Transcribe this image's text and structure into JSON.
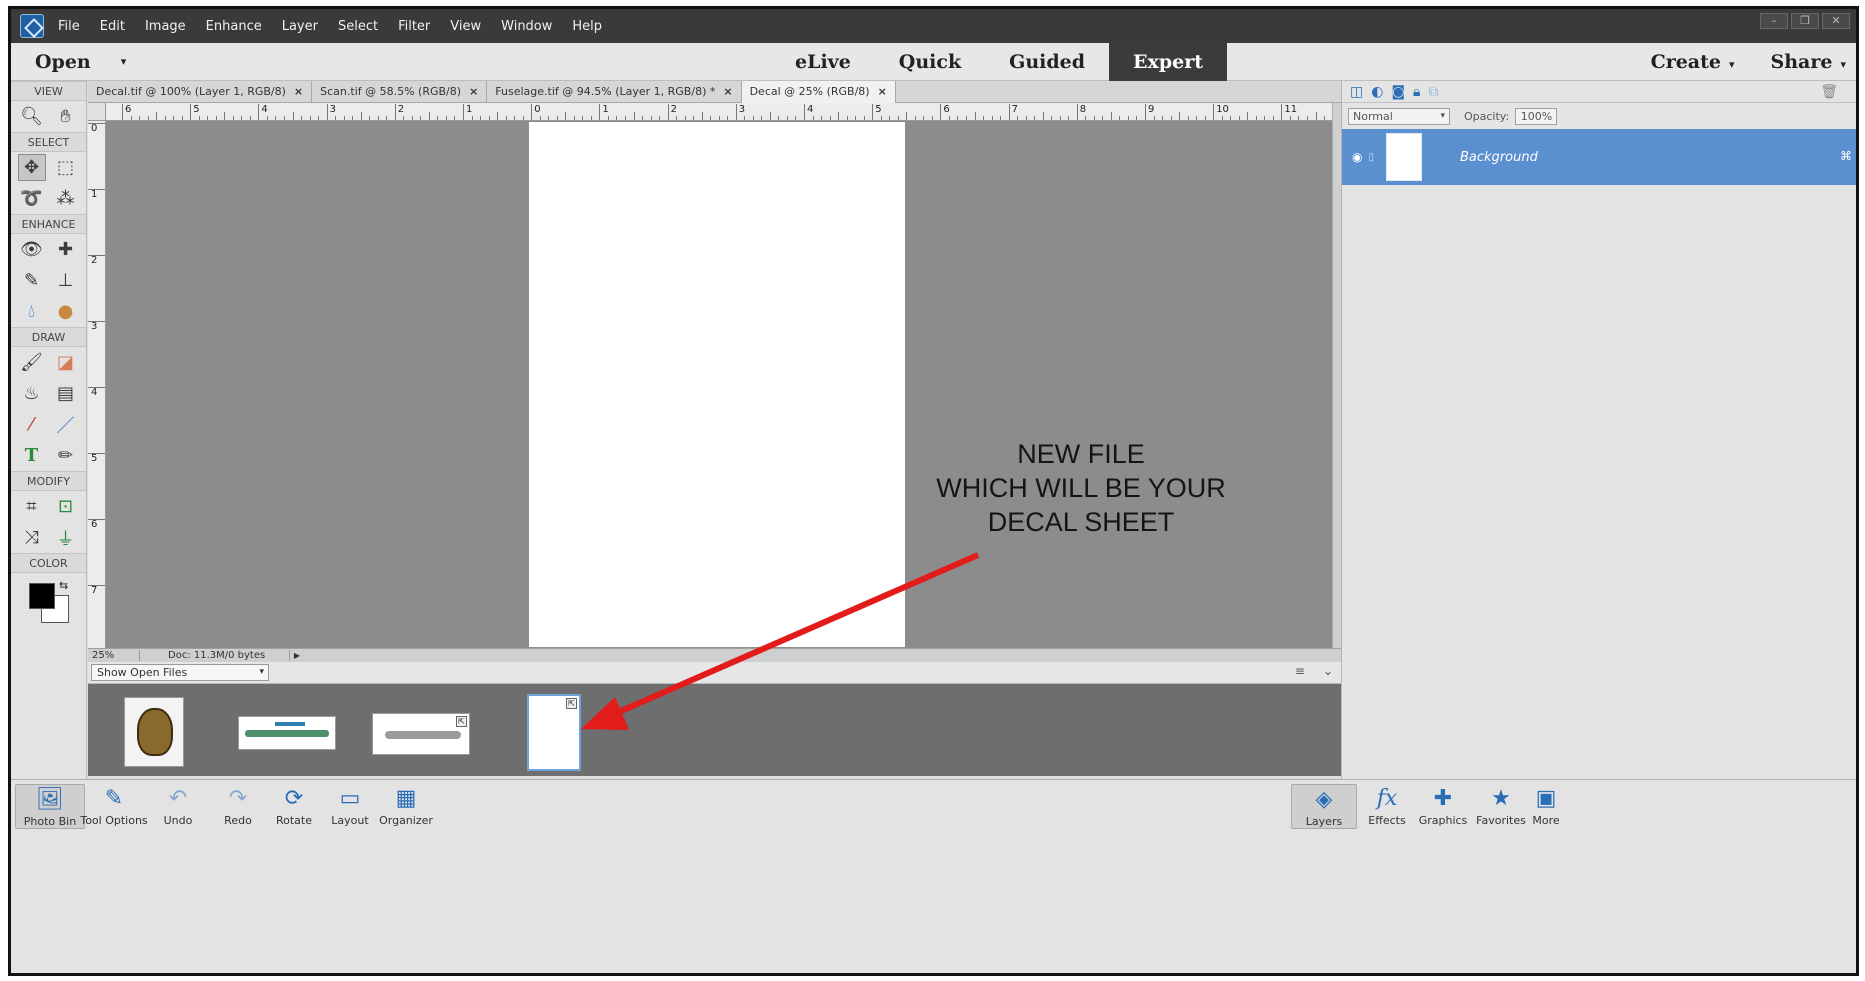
{
  "menubar": {
    "items": [
      "File",
      "Edit",
      "Image",
      "Enhance",
      "Layer",
      "Select",
      "Filter",
      "View",
      "Window",
      "Help"
    ]
  },
  "modebar": {
    "open_label": "Open",
    "modes": [
      "eLive",
      "Quick",
      "Guided",
      "Expert"
    ],
    "active_mode": "Expert",
    "create_label": "Create",
    "share_label": "Share"
  },
  "tools": {
    "sections": {
      "view": "VIEW",
      "select": "SELECT",
      "enhance": "ENHANCE",
      "draw": "DRAW",
      "modify": "MODIFY",
      "color": "COLOR"
    }
  },
  "tabs": [
    {
      "label": "Decal.tif @ 100% (Layer 1, RGB/8)"
    },
    {
      "label": "Scan.tif @ 58.5% (RGB/8)"
    },
    {
      "label": "Fuselage.tif @ 94.5% (Layer 1, RGB/8) *"
    },
    {
      "label": "Decal @ 25% (RGB/8)"
    }
  ],
  "ruler": {
    "h_labels": [
      "6",
      "5",
      "4",
      "3",
      "2",
      "1",
      "0",
      "1",
      "2",
      "3",
      "4",
      "5",
      "6",
      "7",
      "8",
      "9",
      "10",
      "11"
    ],
    "v_labels": [
      "0",
      "1",
      "2",
      "3",
      "4",
      "5",
      "6",
      "7"
    ]
  },
  "status": {
    "zoom": "25%",
    "doc": "Doc: 11.3M/0 bytes"
  },
  "annotation": {
    "line1": "NEW FILE",
    "line2": "WHICH WILL BE YOUR",
    "line3": "DECAL SHEET",
    "arrow_color": "#e21b1b"
  },
  "photobin": {
    "selector": "Show Open Files"
  },
  "layers_panel": {
    "blend_mode": "Normal",
    "opacity_label": "Opacity:",
    "opacity_value": "100%",
    "layer_name": "Background"
  },
  "taskbar": {
    "left": [
      "Photo Bin",
      "Tool Options",
      "Undo",
      "Redo",
      "Rotate",
      "Layout",
      "Organizer"
    ],
    "right": [
      "Layers",
      "Effects",
      "Graphics",
      "Favorites",
      "More"
    ]
  },
  "colors": {
    "accent": "#5a8fd0",
    "canvas_bg": "#8c8c8c",
    "menubar_bg": "#3a3a3a"
  }
}
